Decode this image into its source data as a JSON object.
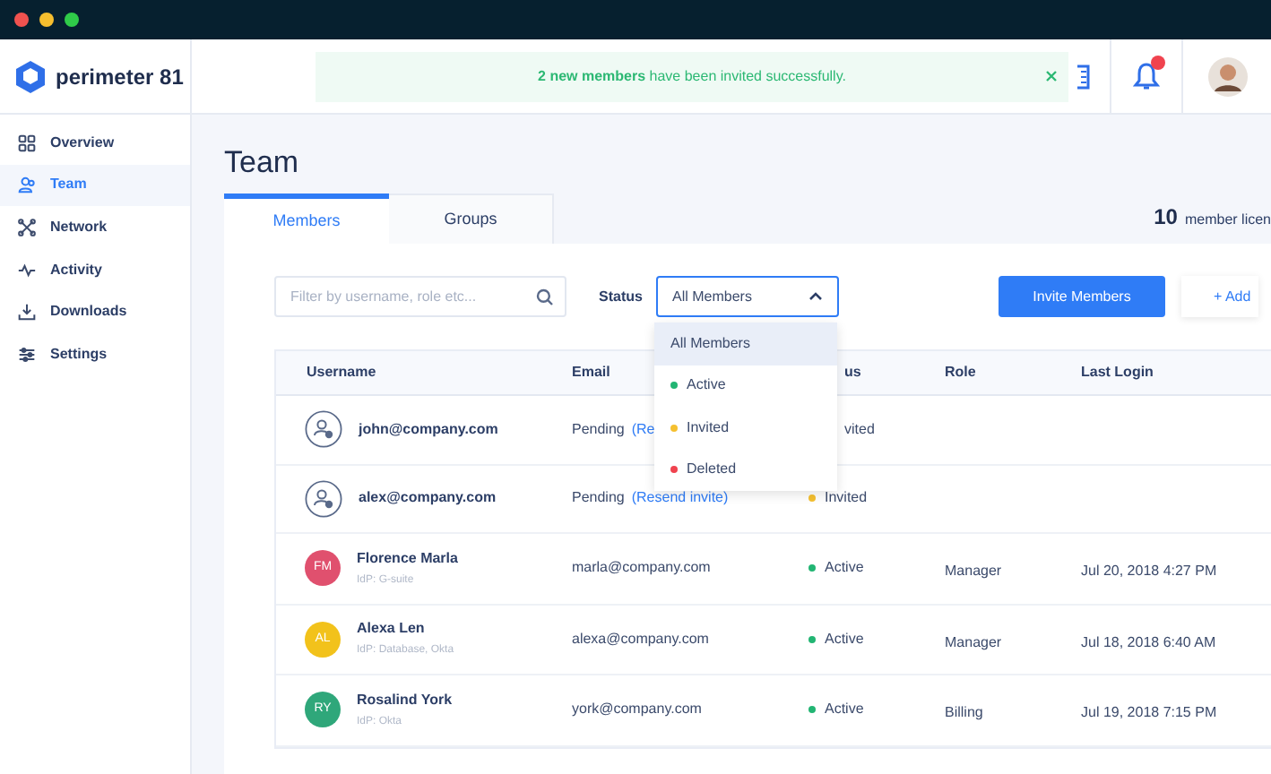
{
  "brand": "perimeter 81",
  "toast": {
    "text": "**2 new members** have been invited successfully."
  },
  "sidebar": {
    "items": [
      {
        "label": "Overview",
        "selected": false
      },
      {
        "label": "Team",
        "selected": true
      },
      {
        "label": "Network",
        "selected": false
      },
      {
        "label": "Activity",
        "selected": false
      },
      {
        "label": "Downloads",
        "selected": false
      },
      {
        "label": "Settings",
        "selected": false
      }
    ]
  },
  "page_title": "Team",
  "tabs": [
    {
      "label": "Members",
      "selected": true
    },
    {
      "label": "Groups",
      "selected": false
    }
  ],
  "license": {
    "count": "10",
    "text": "member licen"
  },
  "filter": {
    "placeholder": "Filter by username, role etc..."
  },
  "status_filter": {
    "label": "Status",
    "value": "All Members",
    "options": [
      {
        "label": "All Members",
        "selected": true
      },
      {
        "label": "Active",
        "color": "#22b573",
        "selected": false
      },
      {
        "label": "Invited",
        "color": "#f5c030",
        "selected": false
      },
      {
        "label": "Deleted",
        "color": "#f0434f",
        "selected": false
      }
    ]
  },
  "buttons": {
    "invite": "Invite Members",
    "add": "+ Add"
  },
  "table": {
    "columns": [
      "Username",
      "Email",
      "us",
      "Role",
      "Last Login"
    ],
    "rows": [
      {
        "kind": "pending",
        "username": "john@company.com",
        "email": "Pending",
        "email_link": "(Re",
        "status": {
          "label": "vited"
        }
      },
      {
        "kind": "pending",
        "username": "alex@company.com",
        "email": "Pending",
        "email_link": "(Resend invite)",
        "status": {
          "label": "Invited",
          "color": "#f5c030"
        }
      },
      {
        "kind": "member",
        "avatar": {
          "initials": "FM",
          "color": "#e0506e"
        },
        "name": "Florence Marla",
        "idp": "IdP: G-suite",
        "email": "marla@company.com",
        "status": {
          "label": "Active",
          "color": "#22b573"
        },
        "role": "Manager",
        "last_login": "Jul 20, 2018 4:27 PM"
      },
      {
        "kind": "member",
        "avatar": {
          "initials": "AL",
          "color": "#f2c21b"
        },
        "name": "Alexa Len",
        "idp": "IdP: Database, Okta",
        "email": "alexa@company.com",
        "status": {
          "label": "Active",
          "color": "#22b573"
        },
        "role": "Manager",
        "last_login": "Jul 18, 2018 6:40 AM"
      },
      {
        "kind": "member",
        "avatar": {
          "initials": "RY",
          "color": "#2fa77a"
        },
        "name": "Rosalind York",
        "idp": "IdP: Okta",
        "email": "york@company.com",
        "status": {
          "label": "Active",
          "color": "#22b573"
        },
        "role": "Billing",
        "last_login": "Jul 19, 2018 7:15 PM"
      }
    ]
  }
}
